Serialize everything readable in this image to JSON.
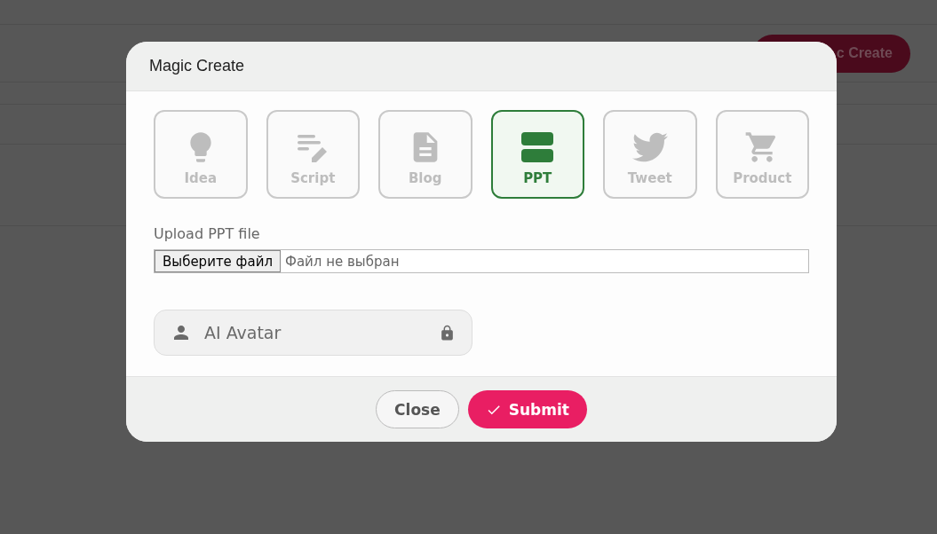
{
  "background": {
    "button": "c Create"
  },
  "dialog": {
    "title": "Magic Create",
    "modes": [
      {
        "label": "Idea",
        "selected": false
      },
      {
        "label": "Script",
        "selected": false
      },
      {
        "label": "Blog",
        "selected": false
      },
      {
        "label": "PPT",
        "selected": true
      },
      {
        "label": "Tweet",
        "selected": false
      },
      {
        "label": "Product",
        "selected": false
      }
    ],
    "upload": {
      "label": "Upload PPT file",
      "button": "Выберите файл",
      "status": "Файл не выбран"
    },
    "avatar": {
      "label": "AI Avatar",
      "locked": true
    },
    "buttons": {
      "close": "Close",
      "submit": "Submit"
    }
  }
}
